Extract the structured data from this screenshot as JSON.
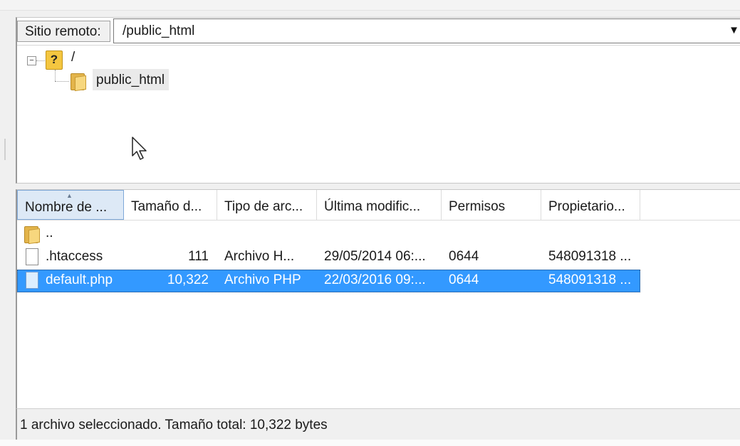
{
  "remote": {
    "label": "Sitio remoto:",
    "path": "/public_html"
  },
  "tree": {
    "root": "/",
    "child": "public_html"
  },
  "columns": [
    "Nombre de ...",
    "Tamaño d...",
    "Tipo de arc...",
    "Última modific...",
    "Permisos",
    "Propietario..."
  ],
  "files": [
    {
      "name": "..",
      "size": "",
      "type": "",
      "modified": "",
      "perms": "",
      "owner": "",
      "icon": "folder-icon"
    },
    {
      "name": ".htaccess",
      "size": "111",
      "type": "Archivo H...",
      "modified": "29/05/2014 06:...",
      "perms": "0644",
      "owner": "548091318 ...",
      "icon": "file-icon"
    },
    {
      "name": "default.php",
      "size": "10,322",
      "type": "Archivo PHP",
      "modified": "22/03/2016 09:...",
      "perms": "0644",
      "owner": "548091318 ...",
      "icon": "php-file-icon",
      "selected": true
    }
  ],
  "status": "1 archivo seleccionado. Tamaño total: 10,322 bytes",
  "colors": {
    "selection": "#3399ff",
    "sorted_header": "#dde9f6",
    "folder": "#e3b44a"
  }
}
